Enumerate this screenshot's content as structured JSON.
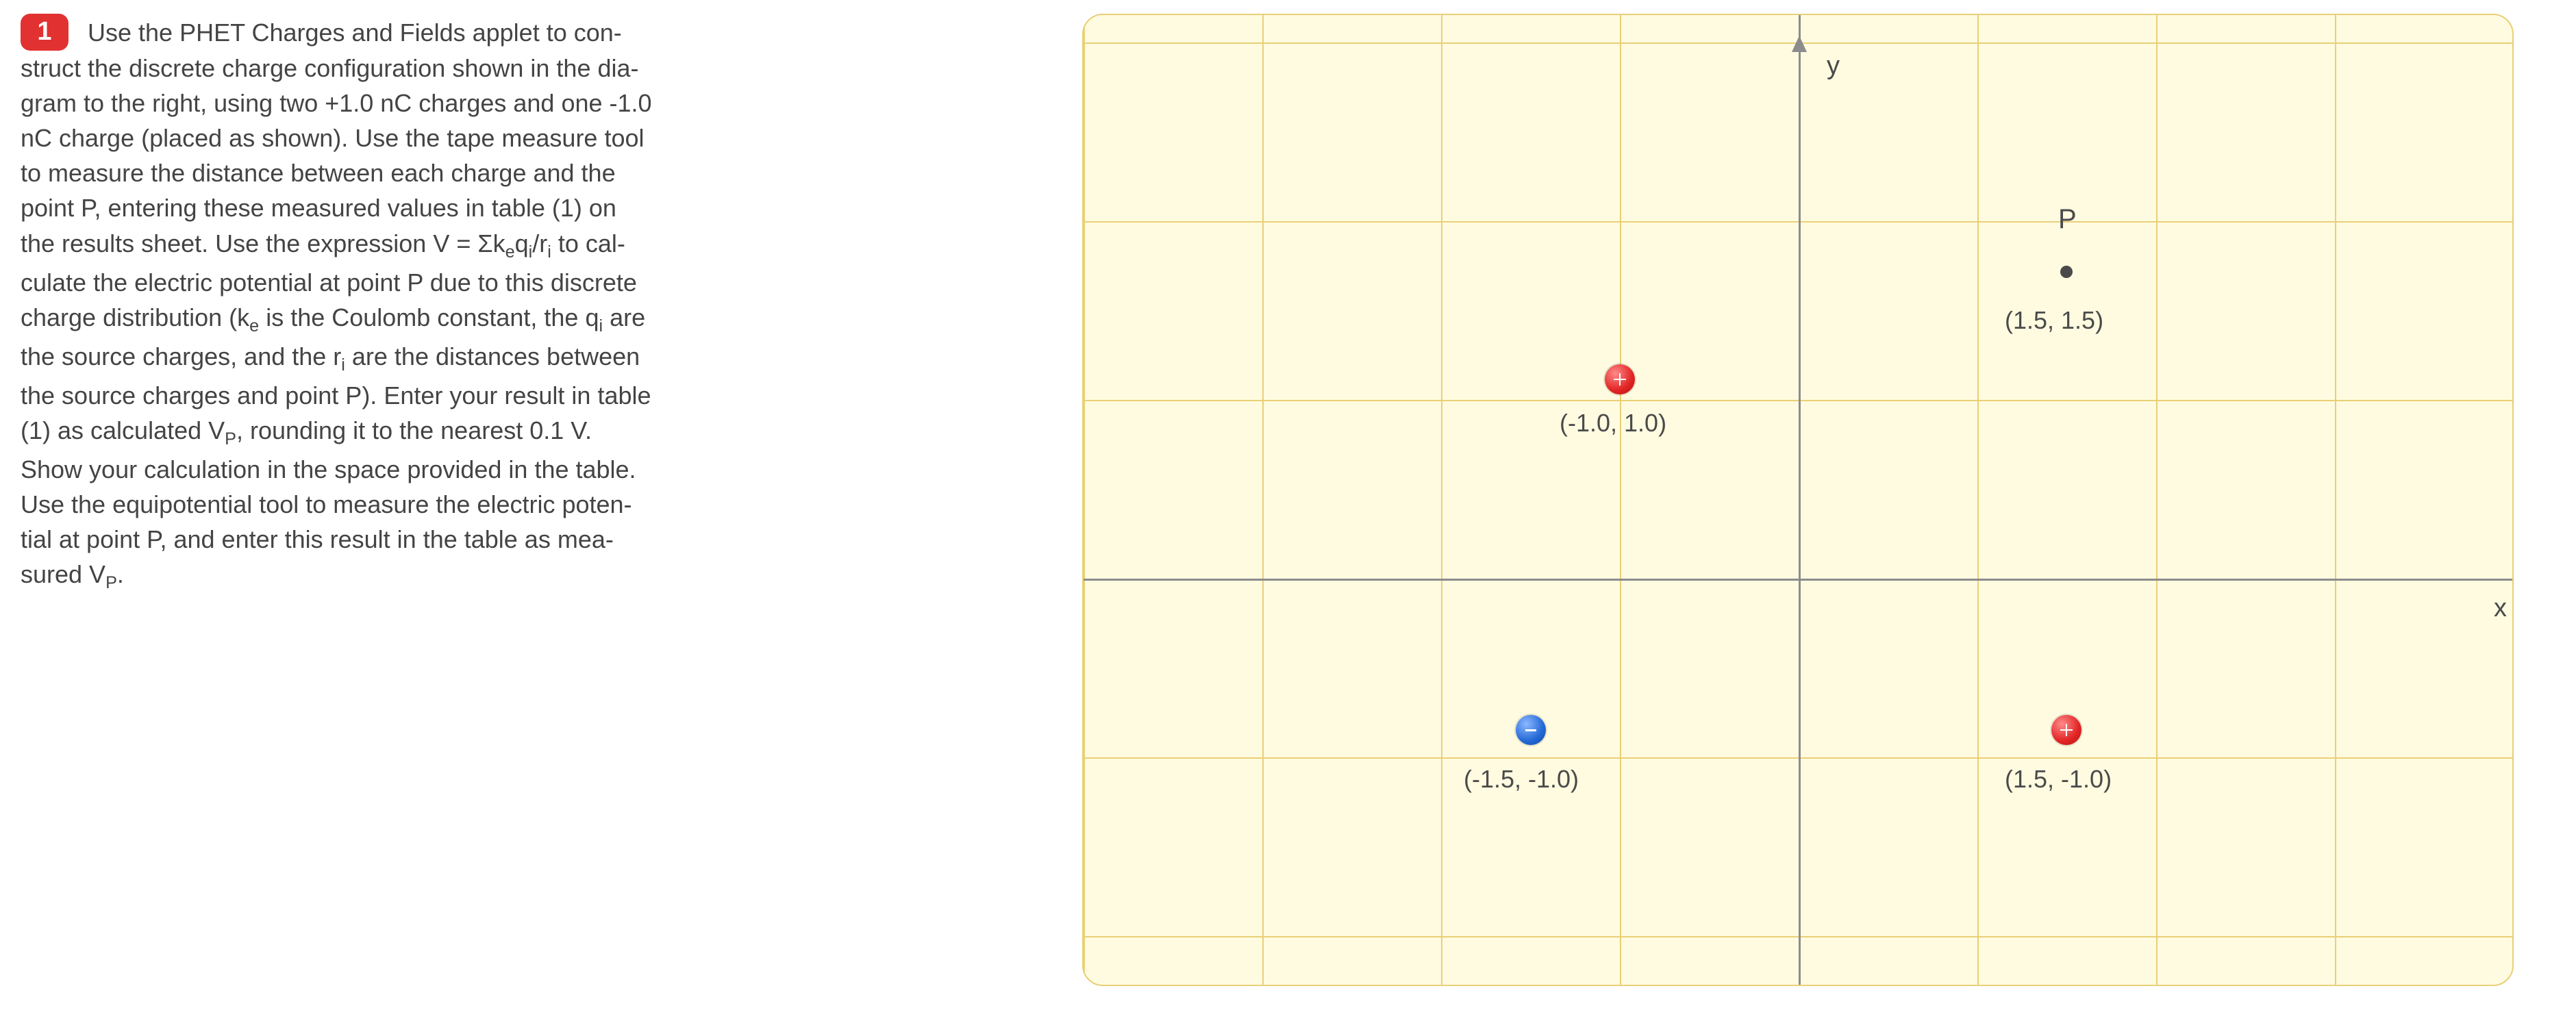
{
  "problem": {
    "number": "1",
    "text_parts": {
      "p1": "Use the PHET Charges and Fields applet to con-",
      "p2": "struct the discrete charge configuration shown in the dia-",
      "p3": "gram to the right, using two +1.0 nC charges and one -1.0",
      "p4": "nC charge (placed as shown). Use the tape measure tool",
      "p5": "to measure the distance between each charge and the",
      "p6": "point P, entering these measured values in table (1) on",
      "p7a": "the results sheet. Use the expression V = Σk",
      "p7_sub1": "e",
      "p7b": "q",
      "p7_sub2": "i",
      "p7c": "/r",
      "p7_sub3": "i",
      "p7d": " to cal-",
      "p8": "culate the electric potential at point P due to this discrete",
      "p9a": "charge distribution (k",
      "p9_sub1": "e",
      "p9b": " is the Coulomb constant, the q",
      "p9_sub2": "i",
      "p9c": " are",
      "p10a": "the source charges, and the r",
      "p10_sub1": "i",
      "p10b": " are the distances between",
      "p11": "the source charges and point P). Enter your result in table",
      "p12a": "(1) as calculated V",
      "p12_sub1": "P",
      "p12b": ", rounding it to the nearest 0.1 V.",
      "p13": "Show your calculation in the space provided in the table.",
      "p14": "Use the equipotential tool to measure the electric poten-",
      "p15": "tial at point P, and enter this result in the table as mea-",
      "p16a": "sured V",
      "p16_sub1": "P",
      "p16b": "."
    }
  },
  "diagram": {
    "x_label": "x",
    "y_label": "y",
    "point_P": {
      "label": "P",
      "coord_label": "(1.5, 1.5)"
    },
    "pos_charge_1": {
      "coord_label": "(-1.0, 1.0)"
    },
    "neg_charge": {
      "coord_label": "(-1.5, -1.0)"
    },
    "pos_charge_2": {
      "coord_label": "(1.5, -1.0)"
    }
  },
  "chart_data": {
    "type": "scatter",
    "title": "Discrete charge configuration",
    "xlabel": "x",
    "ylabel": "y",
    "xlim": [
      -4,
      4
    ],
    "ylim": [
      -2.5,
      3
    ],
    "grid": true,
    "series": [
      {
        "name": "Point P",
        "points": [
          {
            "x": 1.5,
            "y": 1.5
          }
        ],
        "marker": "dot"
      },
      {
        "name": "+1.0 nC charge",
        "points": [
          {
            "x": -1.0,
            "y": 1.0
          }
        ],
        "marker": "plus",
        "color": "#e12323"
      },
      {
        "name": "-1.0 nC charge",
        "points": [
          {
            "x": -1.5,
            "y": -1.0
          }
        ],
        "marker": "minus",
        "color": "#2268d6"
      },
      {
        "name": "+1.0 nC charge",
        "points": [
          {
            "x": 1.5,
            "y": -1.0
          }
        ],
        "marker": "plus",
        "color": "#e12323"
      }
    ],
    "annotations": [
      {
        "text": "P",
        "x": 1.5,
        "y": 1.7
      },
      {
        "text": "(1.5, 1.5)",
        "x": 1.5,
        "y": 1.3
      },
      {
        "text": "(-1.0, 1.0)",
        "x": -1.0,
        "y": 0.8
      },
      {
        "text": "(-1.5, -1.0)",
        "x": -1.5,
        "y": -1.25
      },
      {
        "text": "(1.5, -1.0)",
        "x": 1.5,
        "y": -1.25
      }
    ]
  }
}
